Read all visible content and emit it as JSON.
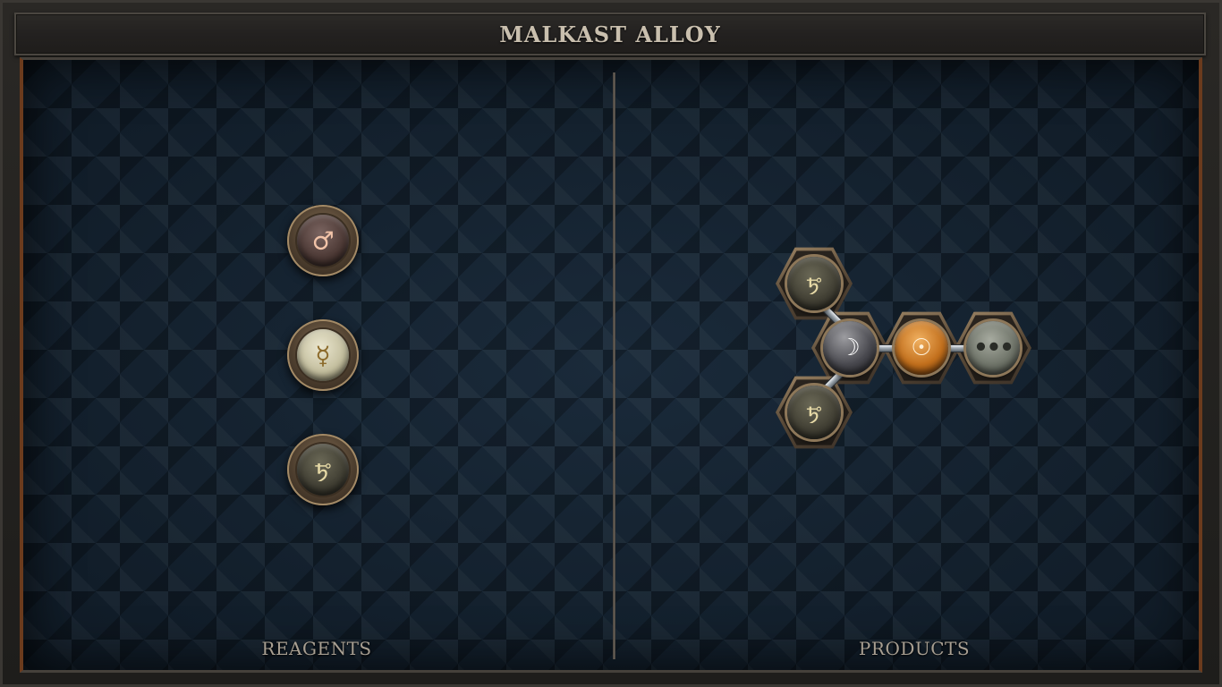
{
  "window": {
    "title": "MALKAST ALLOY"
  },
  "reagents": {
    "label": "REAGENTS",
    "items": [
      {
        "name": "iron",
        "symbol": "♂"
      },
      {
        "name": "quicksilver",
        "symbol": "☿"
      },
      {
        "name": "lead",
        "symbol": "🜪"
      }
    ]
  },
  "products": {
    "label": "PRODUCTS",
    "atoms": [
      {
        "name": "lead",
        "symbol": "🜪"
      },
      {
        "name": "silver",
        "symbol": "☽"
      },
      {
        "name": "gold",
        "symbol": "☉"
      },
      {
        "name": "salt",
        "symbol": "•••"
      },
      {
        "name": "lead",
        "symbol": "🜪"
      }
    ]
  },
  "colors": {
    "board_background": "#13202d",
    "title_text": "#c9bfae",
    "accent_copper": "#6b3b1d"
  }
}
